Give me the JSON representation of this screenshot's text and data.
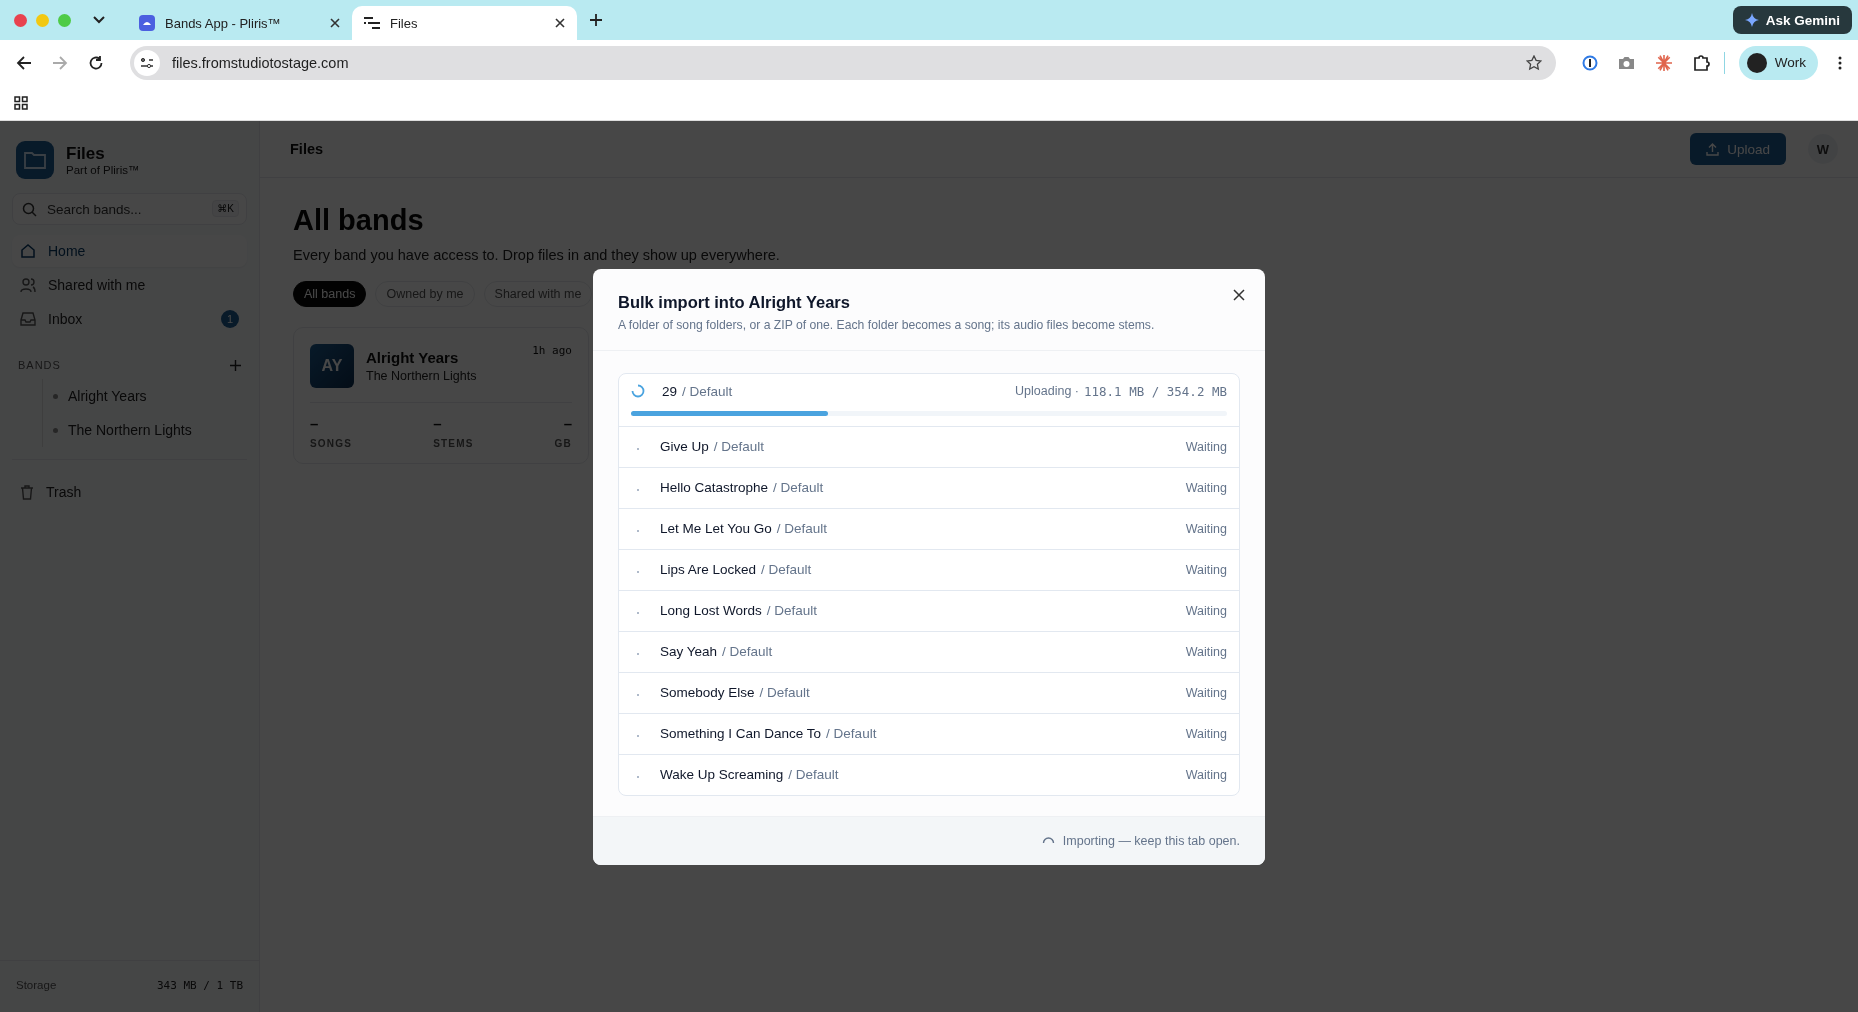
{
  "browser": {
    "tabs": [
      {
        "title": "Bands App - Pliris™",
        "selected": false
      },
      {
        "title": "Files",
        "selected": true
      }
    ],
    "ask_button": "Ask Gemini",
    "url": "files.fromstudiotostage.com",
    "profile": "Work"
  },
  "sidebar": {
    "app_name": "Files",
    "app_subtitle": "Part of Pliris™",
    "search": {
      "placeholder": "Search bands...",
      "shortcut": "⌘K"
    },
    "nav": [
      {
        "label": "Home",
        "selected": true
      },
      {
        "label": "Shared with me",
        "selected": false
      },
      {
        "label": "Inbox",
        "selected": false,
        "badge": "1"
      }
    ],
    "bands_heading": "BANDS",
    "bands": [
      "Alright Years",
      "The Northern Lights"
    ],
    "trash": "Trash",
    "storage": {
      "label": "Storage",
      "value": "343 MB / 1 TB"
    }
  },
  "header": {
    "title": "Files",
    "upload": "Upload",
    "avatar": "W"
  },
  "page": {
    "title": "All bands",
    "subtitle": "Every band you have access to. Drop files in and they show up everywhere.",
    "filters": [
      {
        "label": "All bands",
        "selected": true
      },
      {
        "label": "Owned by me",
        "selected": false
      },
      {
        "label": "Shared with me",
        "selected": false
      }
    ],
    "card": {
      "initials": "AY",
      "name": "Alright Years",
      "band": "The Northern Lights",
      "time": "1h ago",
      "stats": [
        {
          "value": "–",
          "label": "SONGS"
        },
        {
          "value": "–",
          "label": "STEMS"
        },
        {
          "value": "–",
          "label": "GB"
        }
      ]
    }
  },
  "modal": {
    "title": "Bulk import into Alright Years",
    "description": "A folder of song folders, or a ZIP of one. Each folder becomes a song; its audio files become stems.",
    "current": {
      "name": "29",
      "preset": "/ Default",
      "status": "Uploading ·",
      "progress_text": "118.1 MB / 354.2 MB",
      "level": 0.33
    },
    "items": [
      {
        "name": "Give Up",
        "preset": "/ Default",
        "status": "Waiting"
      },
      {
        "name": "Hello Catastrophe",
        "preset": "/ Default",
        "status": "Waiting"
      },
      {
        "name": "Let Me Let You Go",
        "preset": "/ Default",
        "status": "Waiting"
      },
      {
        "name": "Lips Are Locked",
        "preset": "/ Default",
        "status": "Waiting"
      },
      {
        "name": "Long Lost Words",
        "preset": "/ Default",
        "status": "Waiting"
      },
      {
        "name": "Say Yeah",
        "preset": "/ Default",
        "status": "Waiting"
      },
      {
        "name": "Somebody Else",
        "preset": "/ Default",
        "status": "Waiting"
      },
      {
        "name": "Something I Can Dance To",
        "preset": "/ Default",
        "status": "Waiting"
      },
      {
        "name": "Wake Up Screaming",
        "preset": "/ Default",
        "status": "Waiting"
      }
    ],
    "footer": "Importing — keep this tab open."
  }
}
